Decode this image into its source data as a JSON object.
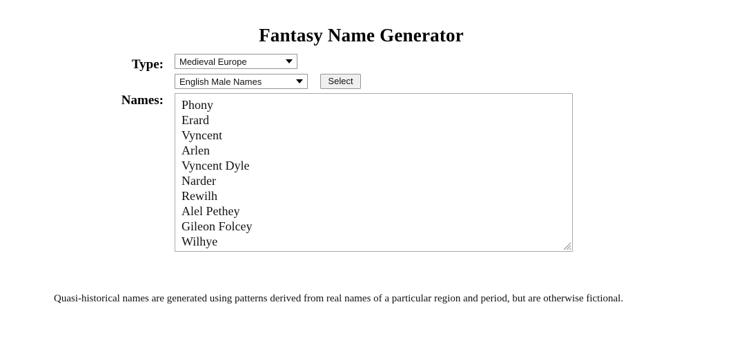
{
  "page": {
    "title": "Fantasy Name Generator",
    "background_color": "#ffffff",
    "text_color": "#000000"
  },
  "form": {
    "type_label": "Type:",
    "names_label": "Names:",
    "type_select": {
      "selected": "Medieval Europe",
      "arrow_icon": "chevron-down-icon"
    },
    "subset_select": {
      "selected": "English Male Names",
      "arrow_icon": "chevron-down-icon"
    },
    "select_button": {
      "label": "Select",
      "background_color": "#efefef",
      "border_color": "#949494"
    }
  },
  "names": {
    "border_color": "#a9a9a9",
    "resize_handle_icon": "resize-grip-icon",
    "list": [
      "Phony",
      "Erard",
      "Vyncent",
      "Arlen",
      "Vyncent Dyle",
      "Narder",
      "Rewilh",
      "Alel Pethey",
      "Gileon Folcey",
      "Wilhye"
    ]
  },
  "footer": {
    "note": "Quasi-historical names are generated using patterns derived from real names of a particular region and period, but are otherwise fictional."
  }
}
